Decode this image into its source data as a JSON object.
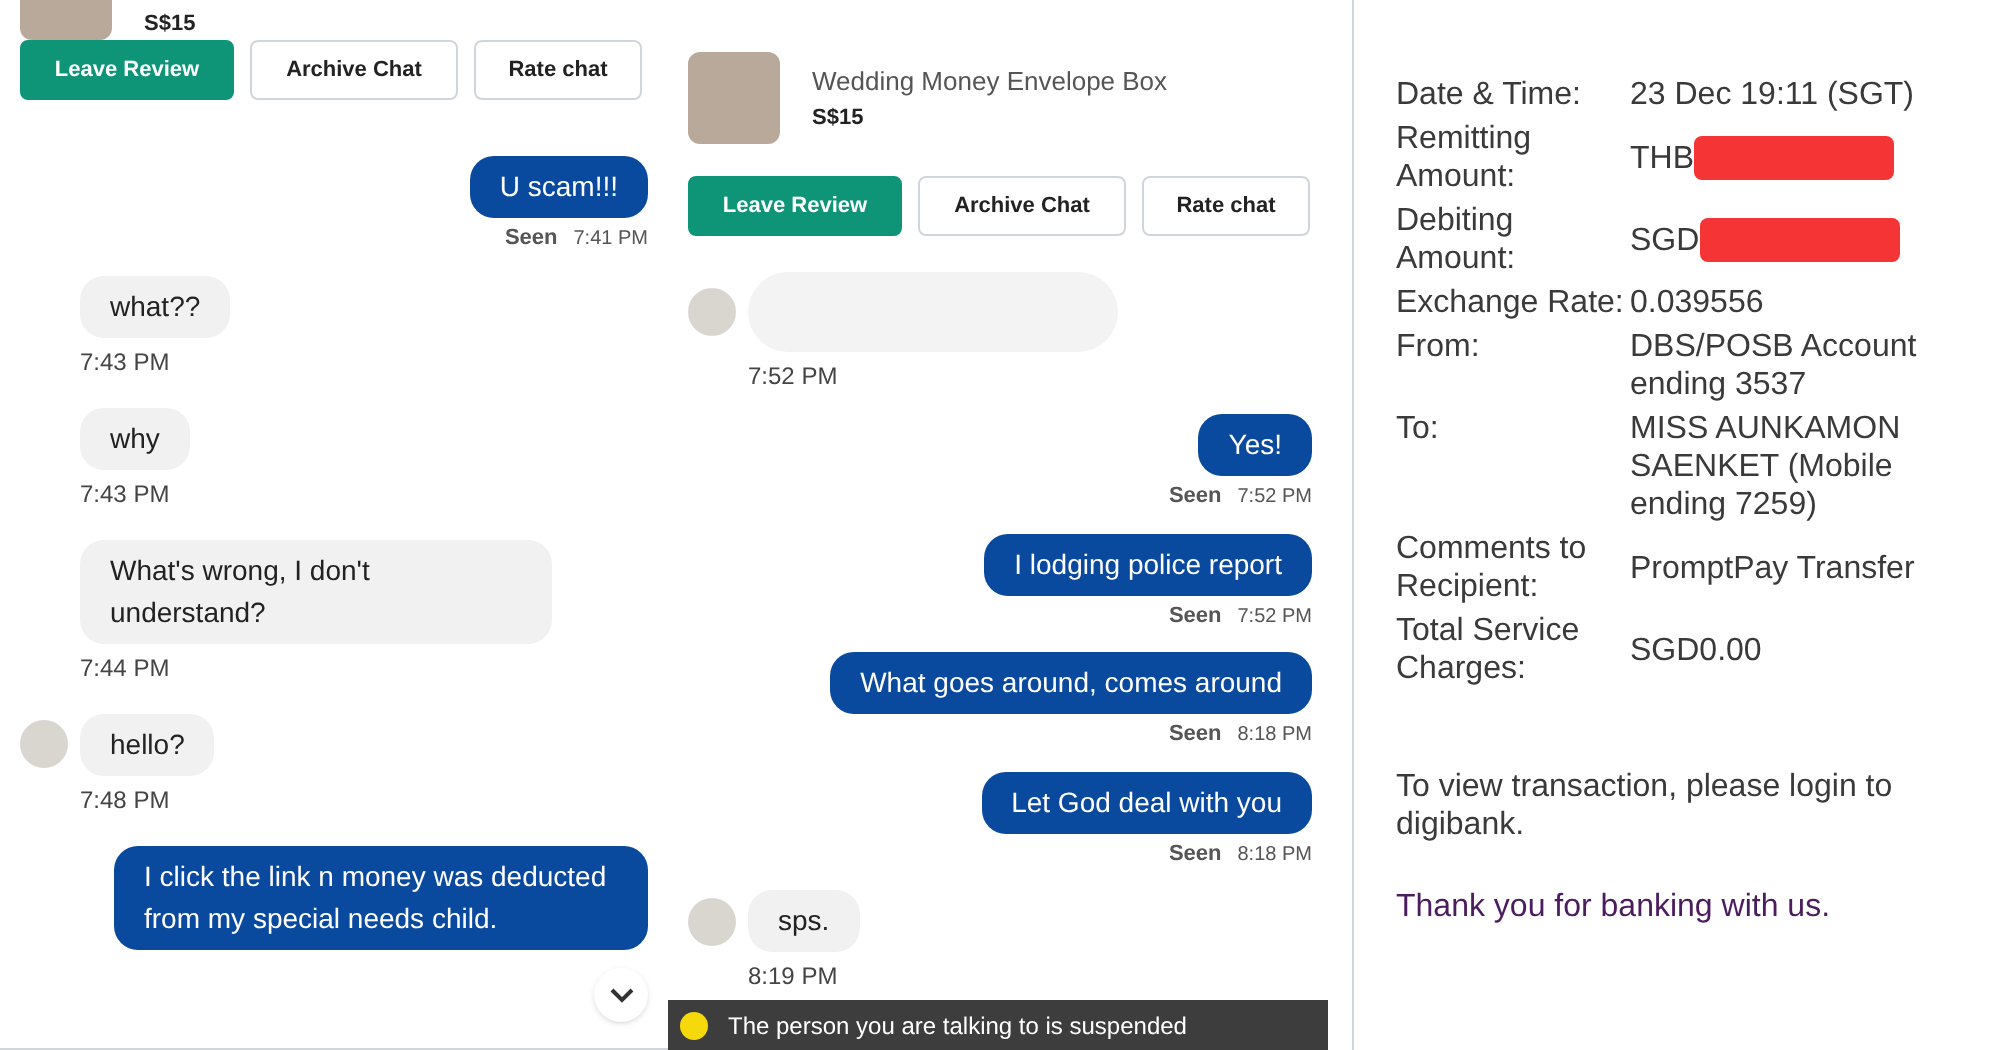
{
  "chats": [
    {
      "product": {
        "price": "S$15"
      },
      "buttons": [
        {
          "label": "Leave Review",
          "kind": "primary"
        },
        {
          "label": "Archive Chat",
          "kind": "outline"
        },
        {
          "label": "Rate chat",
          "kind": "outline"
        }
      ],
      "messages": [
        {
          "kind": "sent",
          "text": "U scam!!!",
          "status": "Seen",
          "time": "7:41 PM"
        },
        {
          "kind": "received",
          "text": "what??",
          "time": "7:43 PM",
          "avatar": false
        },
        {
          "kind": "received",
          "text": "why",
          "time": "7:43 PM",
          "avatar": false
        },
        {
          "kind": "received",
          "text": "What's wrong, I don't understand?",
          "time": "7:44 PM",
          "avatar": false
        },
        {
          "kind": "received",
          "text": "hello?",
          "time": "7:48 PM",
          "avatar": true
        },
        {
          "kind": "sent",
          "text": "I click the link n money was deducted from my special needs child."
        }
      ],
      "scroll_down": true
    },
    {
      "product": {
        "title": "Wedding Money Envelope Box",
        "price": "S$15"
      },
      "buttons": [
        {
          "label": "Leave Review",
          "kind": "primary"
        },
        {
          "label": "Archive Chat",
          "kind": "outline"
        },
        {
          "label": "Rate chat",
          "kind": "outline"
        }
      ],
      "messages": [
        {
          "kind": "redacted",
          "time": "7:52 PM",
          "avatar": true
        },
        {
          "kind": "sent",
          "text": "Yes!",
          "status": "Seen",
          "time": "7:52 PM"
        },
        {
          "kind": "sent",
          "text": "I lodging police report",
          "status": "Seen",
          "time": "7:52 PM"
        },
        {
          "kind": "sent",
          "text": "What goes around, comes around",
          "status": "Seen",
          "time": "8:18 PM"
        },
        {
          "kind": "sent",
          "text": "Let God deal with you",
          "status": "Seen",
          "time": "8:18 PM"
        },
        {
          "kind": "received",
          "text": "sps.",
          "time": "8:19 PM",
          "avatar": true
        }
      ],
      "banner": "The person you are talking to is suspended"
    }
  ],
  "receipt": {
    "rows": [
      {
        "label": "Date & Time:",
        "value": "23 Dec 19:11 (SGT)",
        "redacted": false
      },
      {
        "label": "Remitting Amount:",
        "value": "THB",
        "redacted": true
      },
      {
        "label": "Debiting Amount:",
        "value": "SGD",
        "redacted": true
      },
      {
        "label": "Exchange Rate:",
        "value": "0.039556",
        "redacted": false
      },
      {
        "label": "From:",
        "value": "DBS/POSB Account ending 3537",
        "redacted": false
      },
      {
        "label": "To:",
        "value": "MISS AUNKAMON SAENKET (Mobile ending 7259)",
        "redacted": false
      },
      {
        "label": "Comments to Recipient:",
        "value": "PromptPay Transfer",
        "redacted": false
      },
      {
        "label": "Total Service Charges:",
        "value": "SGD0.00",
        "redacted": false
      }
    ],
    "note": "To view transaction, please login to digibank.",
    "thanks": "Thank you for banking with us."
  }
}
